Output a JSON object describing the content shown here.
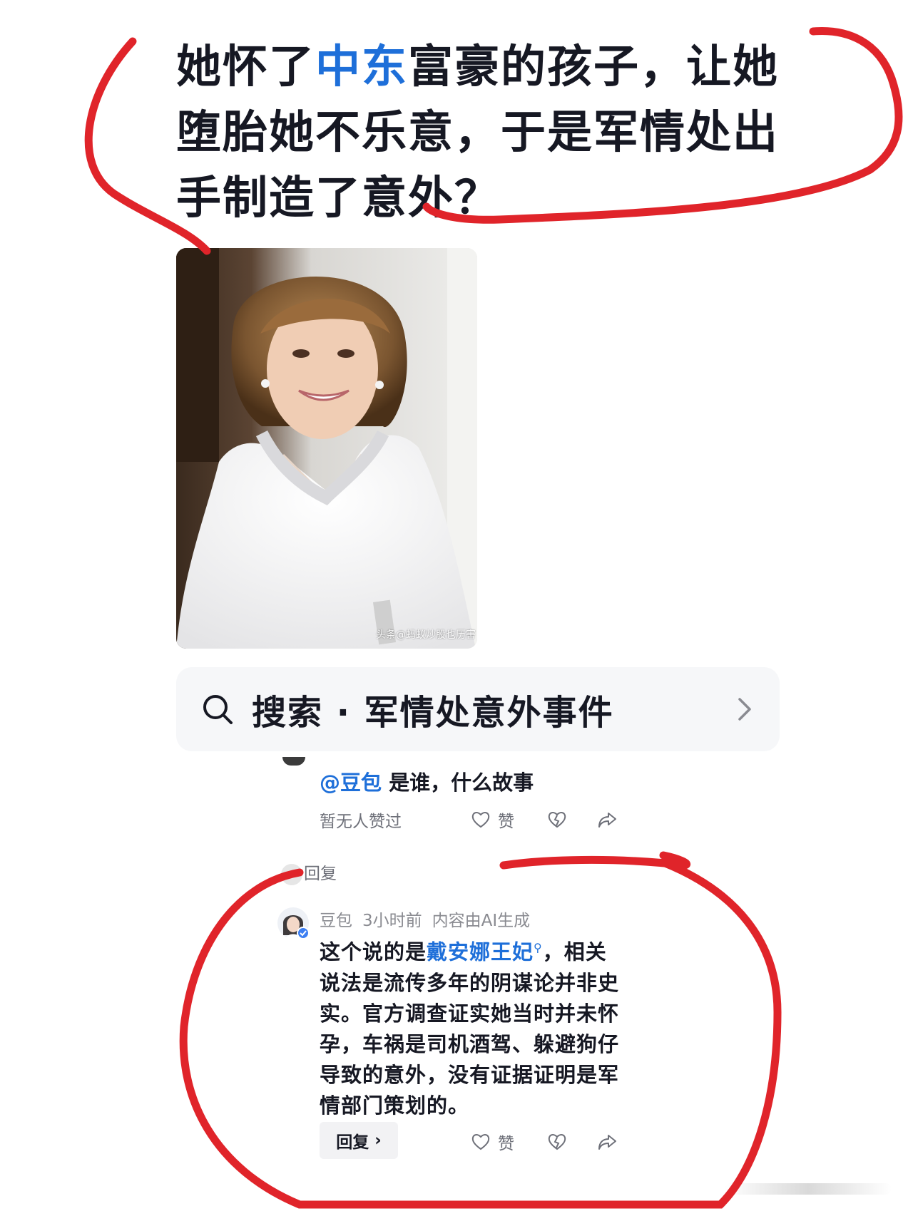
{
  "post": {
    "headline_part1": "她怀了",
    "headline_highlight": "中东",
    "headline_part2": "富豪的孩子，让她堕胎她不乐意，于是军情处出手制造了意外？",
    "image_watermark": "头条@蚂蚁炒股也历害"
  },
  "search": {
    "label": "搜索 · 军情处意外事件",
    "icon": "search-icon",
    "chevron_icon": "chevron-right-icon"
  },
  "comment1": {
    "mention": "@豆包",
    "text": " 是谁，什么故事",
    "meta": "暂无人赞过",
    "like_label": "赞"
  },
  "replies_label": "回复",
  "ai_reply": {
    "author": "豆包",
    "time": "3小时前",
    "ai_notice": "内容由AI生成",
    "text_part1": "这个说的是",
    "link_text": "戴安娜王妃",
    "text_part2": "，相关说法是流传多年的阴谋论并非史实。官方调查证实她当时并未怀孕，车祸是司机酒驾、躲避狗仔导致的意外，没有证据证明是军情部门策划的。",
    "reply_button": "回复",
    "like_label": "赞"
  },
  "colors": {
    "accent_blue": "#1e6fd9",
    "annotation_red": "#e0242a",
    "text_primary": "#161823",
    "text_secondary": "#6e7079"
  }
}
